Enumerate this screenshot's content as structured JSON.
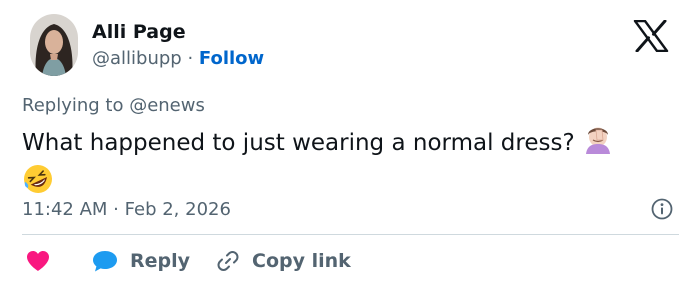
{
  "author": {
    "display_name": "Alli Page",
    "handle": "@allibupp",
    "separator": " · ",
    "follow_label": "Follow"
  },
  "reply": {
    "prefix": "Replying to ",
    "to": "@enews"
  },
  "tweet": {
    "text_before_emoji": "What happened to just wearing a normal dress? ",
    "emojis": [
      "face-palm-emoji",
      "rolling-laughing-emoji"
    ]
  },
  "meta": {
    "time": "11:42 AM",
    "dot": " · ",
    "date": "Feb 2, 2026"
  },
  "actions": {
    "reply_label": "Reply",
    "copy_link_label": "Copy link"
  },
  "colors": {
    "text": "#0f1419",
    "muted": "#536471",
    "link": "#0066cc",
    "heart": "#f91880",
    "reply_icon": "#1d9bf0",
    "divider": "#cfd9de"
  }
}
